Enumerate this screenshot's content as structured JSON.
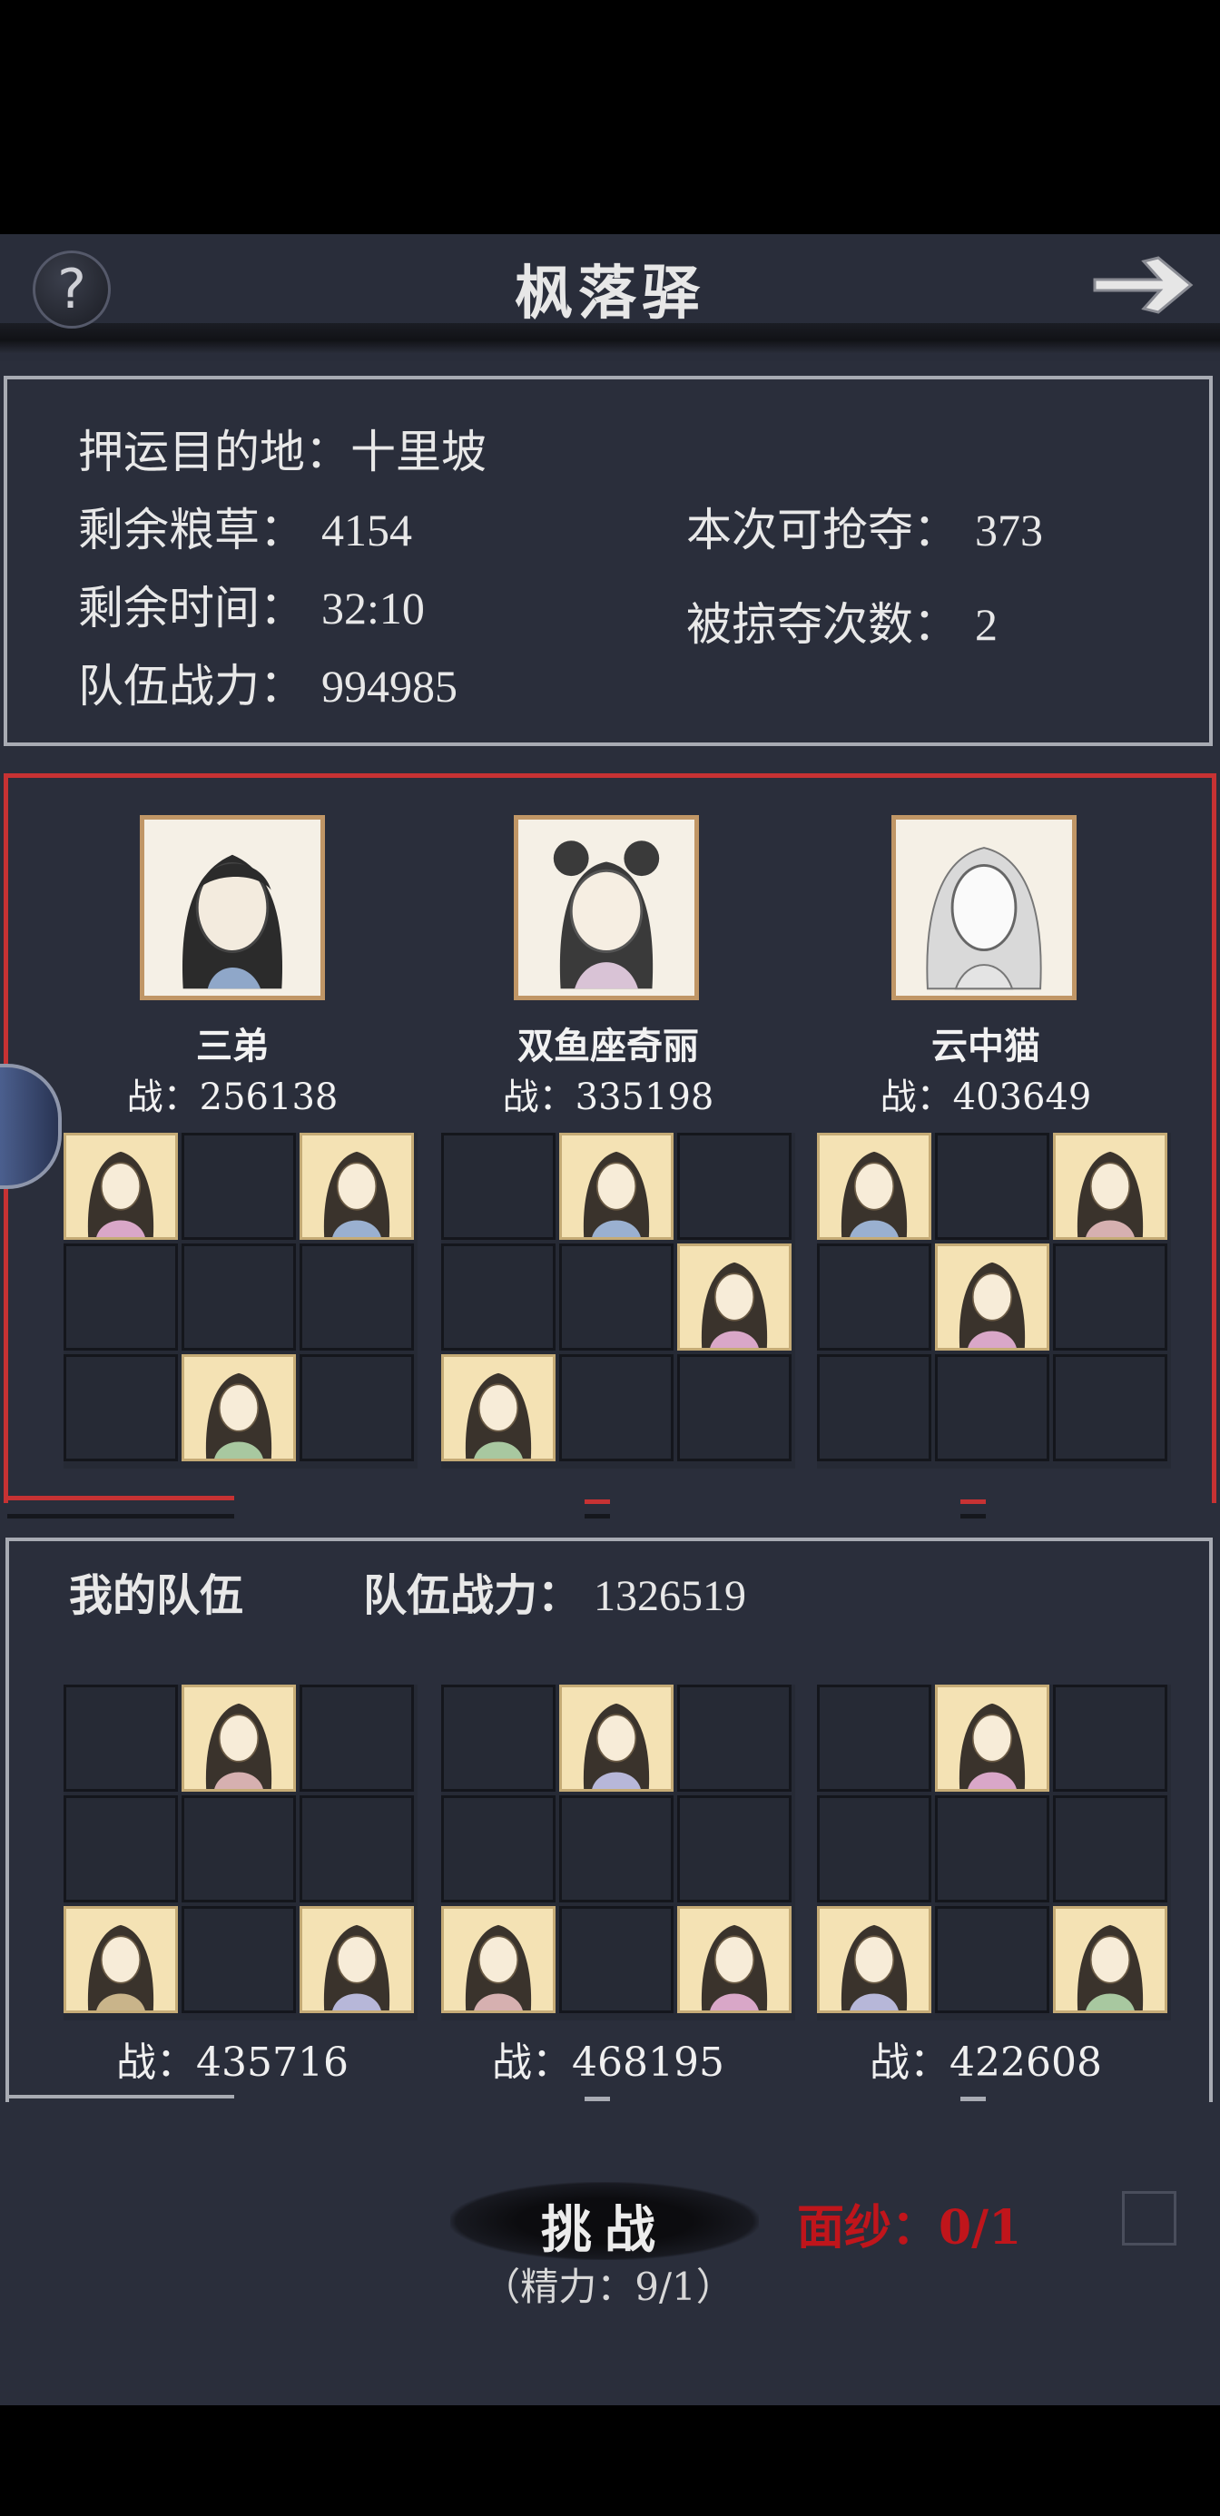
{
  "header": {
    "title": "枫落驿",
    "help_label": "?"
  },
  "escort_info": {
    "destination_label": "押运目的地：",
    "destination": "十里坡",
    "remaining_food_label": "剩余粮草：",
    "remaining_food": "4154",
    "remaining_time_label": "剩余时间：",
    "remaining_time": "32:10",
    "team_power_label": "队伍战力：",
    "team_power": "994985",
    "loot_label": "本次可抢夺：",
    "loot": "373",
    "plundered_label": "被掠夺次数：",
    "plundered": "2"
  },
  "enemy_teams": [
    {
      "leader": "三弟",
      "power_label": "战：",
      "power": "256138",
      "filled_cells": [
        0,
        2,
        7
      ]
    },
    {
      "leader": "双鱼座奇丽",
      "power_label": "战：",
      "power": "335198",
      "filled_cells": [
        1,
        5,
        6
      ]
    },
    {
      "leader": "云中猫",
      "power_label": "战：",
      "power": "403649",
      "filled_cells": [
        0,
        2,
        4
      ]
    }
  ],
  "my_team": {
    "title": "我的队伍",
    "power_label": "队伍战力：",
    "power": "1326519",
    "teams": [
      {
        "power_label": "战：",
        "power": "435716",
        "filled_cells": [
          1,
          6,
          8
        ]
      },
      {
        "power_label": "战：",
        "power": "468195",
        "filled_cells": [
          1,
          6,
          8
        ]
      },
      {
        "power_label": "战：",
        "power": "422608",
        "filled_cells": [
          1,
          6,
          8
        ]
      }
    ]
  },
  "actions": {
    "challenge_label": "挑战",
    "stamina_text": "（精力：9/1）",
    "mask_label": "面纱：0/1"
  },
  "colors": {
    "background": "#2a2e3b",
    "enemy_border": "#c73233",
    "mask_text": "#c0151b",
    "portrait_frame": "#c09666",
    "portrait_bg": "#f4e2b4"
  }
}
